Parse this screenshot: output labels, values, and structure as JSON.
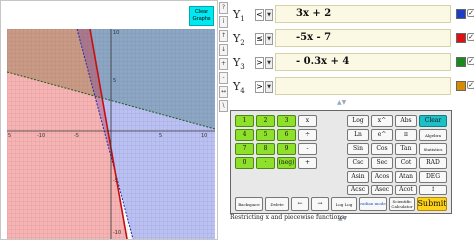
{
  "graph": {
    "clear_button_line1": "Clear",
    "clear_button_line2": "Graphs",
    "x_ticks": [
      "5",
      "-10",
      "-5",
      "5",
      "10"
    ],
    "y_ticks": [
      "10",
      "5",
      "-5",
      "-10"
    ],
    "background_color": "#ffffff"
  },
  "toolbar": {
    "buttons": [
      "?",
      "i",
      "↑",
      "↓",
      "+",
      "-",
      "↔",
      "\\"
    ]
  },
  "equations": [
    {
      "label": "Y",
      "sub": "1",
      "op": "<",
      "expr": "3x + 2",
      "color": "#1a3ec8",
      "checked": "✓"
    },
    {
      "label": "Y",
      "sub": "2",
      "op": "≤",
      "expr": "-5x - 7",
      "color": "#dd1111",
      "checked": "✓"
    },
    {
      "label": "Y",
      "sub": "3",
      "op": ">",
      "expr": "- 0.3x + 4",
      "color": "#1a8a1a",
      "checked": "✓"
    },
    {
      "label": "Y",
      "sub": "4",
      "op": ">",
      "expr": "",
      "color": "#d88a00",
      "checked": "✓"
    }
  ],
  "keypad": {
    "rows": [
      [
        "1",
        "2",
        "3",
        "x",
        "Log",
        "x^",
        "Abs",
        "Clear"
      ],
      [
        "4",
        "5",
        "6",
        "÷",
        "Ln",
        "e^",
        "π",
        "Algebra"
      ],
      [
        "7",
        "8",
        "9",
        "-",
        "Sin",
        "Cos",
        "Tan",
        "Statistics"
      ],
      [
        "0",
        "·",
        "(neg)",
        "+",
        "Csc",
        "Sec",
        "Cot",
        "RAD"
      ],
      [
        "",
        "",
        "",
        "",
        "Asin",
        "Acos",
        "Atan",
        "DEG"
      ],
      [
        "",
        "",
        "",
        "",
        "Acsc",
        "Asec",
        "Acot",
        "↕"
      ],
      [
        "Backspace",
        "Delete",
        "←",
        "→",
        "Log Log",
        "radian mode",
        "Scientific Calculator",
        "Submit"
      ]
    ]
  },
  "footer": {
    "text": "Restricting x and piecewise functions:"
  }
}
